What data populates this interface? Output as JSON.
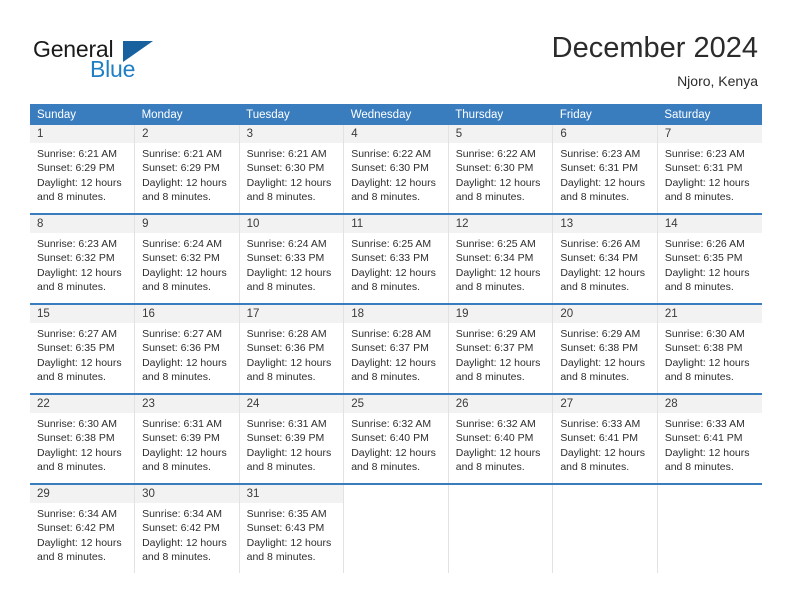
{
  "brand": {
    "name_top": "General",
    "name_bottom": "Blue",
    "accent_color": "#17619e",
    "blue_text_color": "#1f7fc4"
  },
  "header": {
    "title": "December 2024",
    "location": "Njoro, Kenya"
  },
  "calendar": {
    "header_color": "#3a7dbf",
    "weekday_headers": [
      "Sunday",
      "Monday",
      "Tuesday",
      "Wednesday",
      "Thursday",
      "Friday",
      "Saturday"
    ],
    "labels": {
      "sunrise": "Sunrise:",
      "sunset": "Sunset:",
      "daylight": "Daylight:"
    },
    "weeks": [
      [
        {
          "day": "1",
          "sunrise": "Sunrise: 6:21 AM",
          "sunset": "Sunset: 6:29 PM",
          "daylight": "Daylight: 12 hours and 8 minutes."
        },
        {
          "day": "2",
          "sunrise": "Sunrise: 6:21 AM",
          "sunset": "Sunset: 6:29 PM",
          "daylight": "Daylight: 12 hours and 8 minutes."
        },
        {
          "day": "3",
          "sunrise": "Sunrise: 6:21 AM",
          "sunset": "Sunset: 6:30 PM",
          "daylight": "Daylight: 12 hours and 8 minutes."
        },
        {
          "day": "4",
          "sunrise": "Sunrise: 6:22 AM",
          "sunset": "Sunset: 6:30 PM",
          "daylight": "Daylight: 12 hours and 8 minutes."
        },
        {
          "day": "5",
          "sunrise": "Sunrise: 6:22 AM",
          "sunset": "Sunset: 6:30 PM",
          "daylight": "Daylight: 12 hours and 8 minutes."
        },
        {
          "day": "6",
          "sunrise": "Sunrise: 6:23 AM",
          "sunset": "Sunset: 6:31 PM",
          "daylight": "Daylight: 12 hours and 8 minutes."
        },
        {
          "day": "7",
          "sunrise": "Sunrise: 6:23 AM",
          "sunset": "Sunset: 6:31 PM",
          "daylight": "Daylight: 12 hours and 8 minutes."
        }
      ],
      [
        {
          "day": "8",
          "sunrise": "Sunrise: 6:23 AM",
          "sunset": "Sunset: 6:32 PM",
          "daylight": "Daylight: 12 hours and 8 minutes."
        },
        {
          "day": "9",
          "sunrise": "Sunrise: 6:24 AM",
          "sunset": "Sunset: 6:32 PM",
          "daylight": "Daylight: 12 hours and 8 minutes."
        },
        {
          "day": "10",
          "sunrise": "Sunrise: 6:24 AM",
          "sunset": "Sunset: 6:33 PM",
          "daylight": "Daylight: 12 hours and 8 minutes."
        },
        {
          "day": "11",
          "sunrise": "Sunrise: 6:25 AM",
          "sunset": "Sunset: 6:33 PM",
          "daylight": "Daylight: 12 hours and 8 minutes."
        },
        {
          "day": "12",
          "sunrise": "Sunrise: 6:25 AM",
          "sunset": "Sunset: 6:34 PM",
          "daylight": "Daylight: 12 hours and 8 minutes."
        },
        {
          "day": "13",
          "sunrise": "Sunrise: 6:26 AM",
          "sunset": "Sunset: 6:34 PM",
          "daylight": "Daylight: 12 hours and 8 minutes."
        },
        {
          "day": "14",
          "sunrise": "Sunrise: 6:26 AM",
          "sunset": "Sunset: 6:35 PM",
          "daylight": "Daylight: 12 hours and 8 minutes."
        }
      ],
      [
        {
          "day": "15",
          "sunrise": "Sunrise: 6:27 AM",
          "sunset": "Sunset: 6:35 PM",
          "daylight": "Daylight: 12 hours and 8 minutes."
        },
        {
          "day": "16",
          "sunrise": "Sunrise: 6:27 AM",
          "sunset": "Sunset: 6:36 PM",
          "daylight": "Daylight: 12 hours and 8 minutes."
        },
        {
          "day": "17",
          "sunrise": "Sunrise: 6:28 AM",
          "sunset": "Sunset: 6:36 PM",
          "daylight": "Daylight: 12 hours and 8 minutes."
        },
        {
          "day": "18",
          "sunrise": "Sunrise: 6:28 AM",
          "sunset": "Sunset: 6:37 PM",
          "daylight": "Daylight: 12 hours and 8 minutes."
        },
        {
          "day": "19",
          "sunrise": "Sunrise: 6:29 AM",
          "sunset": "Sunset: 6:37 PM",
          "daylight": "Daylight: 12 hours and 8 minutes."
        },
        {
          "day": "20",
          "sunrise": "Sunrise: 6:29 AM",
          "sunset": "Sunset: 6:38 PM",
          "daylight": "Daylight: 12 hours and 8 minutes."
        },
        {
          "day": "21",
          "sunrise": "Sunrise: 6:30 AM",
          "sunset": "Sunset: 6:38 PM",
          "daylight": "Daylight: 12 hours and 8 minutes."
        }
      ],
      [
        {
          "day": "22",
          "sunrise": "Sunrise: 6:30 AM",
          "sunset": "Sunset: 6:38 PM",
          "daylight": "Daylight: 12 hours and 8 minutes."
        },
        {
          "day": "23",
          "sunrise": "Sunrise: 6:31 AM",
          "sunset": "Sunset: 6:39 PM",
          "daylight": "Daylight: 12 hours and 8 minutes."
        },
        {
          "day": "24",
          "sunrise": "Sunrise: 6:31 AM",
          "sunset": "Sunset: 6:39 PM",
          "daylight": "Daylight: 12 hours and 8 minutes."
        },
        {
          "day": "25",
          "sunrise": "Sunrise: 6:32 AM",
          "sunset": "Sunset: 6:40 PM",
          "daylight": "Daylight: 12 hours and 8 minutes."
        },
        {
          "day": "26",
          "sunrise": "Sunrise: 6:32 AM",
          "sunset": "Sunset: 6:40 PM",
          "daylight": "Daylight: 12 hours and 8 minutes."
        },
        {
          "day": "27",
          "sunrise": "Sunrise: 6:33 AM",
          "sunset": "Sunset: 6:41 PM",
          "daylight": "Daylight: 12 hours and 8 minutes."
        },
        {
          "day": "28",
          "sunrise": "Sunrise: 6:33 AM",
          "sunset": "Sunset: 6:41 PM",
          "daylight": "Daylight: 12 hours and 8 minutes."
        }
      ],
      [
        {
          "day": "29",
          "sunrise": "Sunrise: 6:34 AM",
          "sunset": "Sunset: 6:42 PM",
          "daylight": "Daylight: 12 hours and 8 minutes."
        },
        {
          "day": "30",
          "sunrise": "Sunrise: 6:34 AM",
          "sunset": "Sunset: 6:42 PM",
          "daylight": "Daylight: 12 hours and 8 minutes."
        },
        {
          "day": "31",
          "sunrise": "Sunrise: 6:35 AM",
          "sunset": "Sunset: 6:43 PM",
          "daylight": "Daylight: 12 hours and 8 minutes."
        },
        {
          "day": "",
          "sunrise": "",
          "sunset": "",
          "daylight": ""
        },
        {
          "day": "",
          "sunrise": "",
          "sunset": "",
          "daylight": ""
        },
        {
          "day": "",
          "sunrise": "",
          "sunset": "",
          "daylight": ""
        },
        {
          "day": "",
          "sunrise": "",
          "sunset": "",
          "daylight": ""
        }
      ]
    ]
  }
}
